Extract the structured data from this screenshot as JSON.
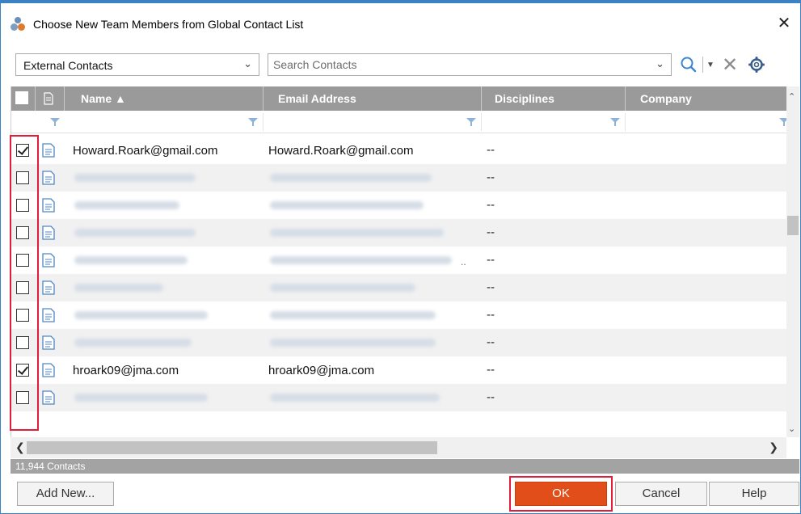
{
  "dialog": {
    "title": "Choose New Team Members from Global Contact List",
    "close_glyph": "✕"
  },
  "toolbar": {
    "contact_source": "External Contacts",
    "search_placeholder": "Search Contacts",
    "search_value": ""
  },
  "grid": {
    "columns": [
      {
        "label": "Name ▲"
      },
      {
        "label": "Email Address"
      },
      {
        "label": "Disciplines"
      },
      {
        "label": "Company"
      }
    ],
    "rows": [
      {
        "checked": true,
        "name": "Howard.Roark@gmail.com",
        "email": "Howard.Roark@gmail.com",
        "disciplines": "--",
        "redacted": false
      },
      {
        "checked": false,
        "name": "",
        "email": "",
        "disciplines": "--",
        "redacted": true
      },
      {
        "checked": false,
        "name": "",
        "email": "",
        "disciplines": "--",
        "redacted": true
      },
      {
        "checked": false,
        "name": "",
        "email": "",
        "disciplines": "--",
        "redacted": true
      },
      {
        "checked": false,
        "name": "",
        "email": "",
        "disciplines": "--",
        "redacted": true,
        "email_suffix": ".."
      },
      {
        "checked": false,
        "name": "",
        "email": "",
        "disciplines": "--",
        "redacted": true
      },
      {
        "checked": false,
        "name": "",
        "email": "",
        "disciplines": "--",
        "redacted": true
      },
      {
        "checked": false,
        "name": "",
        "email": "",
        "disciplines": "--",
        "redacted": true
      },
      {
        "checked": true,
        "name": "hroark09@jma.com",
        "email": "hroark09@jma.com",
        "disciplines": "--",
        "redacted": false
      },
      {
        "checked": false,
        "name": "",
        "email": "",
        "disciplines": "--",
        "redacted": true
      }
    ]
  },
  "status": {
    "count_text": "11,944 Contacts"
  },
  "footer": {
    "add_new_label": "Add New...",
    "ok_label": "OK",
    "cancel_label": "Cancel",
    "help_label": "Help"
  },
  "colors": {
    "accent_border": "#3b82c4",
    "header_bg": "#9a9a9a",
    "ok_bg": "#e24e1a",
    "highlight_outline": "#e21d3b"
  },
  "icons": [
    "team-icon",
    "close-icon",
    "chevron-down-icon",
    "search-icon",
    "dropdown-arrow-icon",
    "clear-icon",
    "gear-icon",
    "document-icon",
    "filter-icon",
    "sort-ascending-icon",
    "scroll-left-icon",
    "scroll-right-icon",
    "scroll-up-icon",
    "scroll-down-icon"
  ]
}
